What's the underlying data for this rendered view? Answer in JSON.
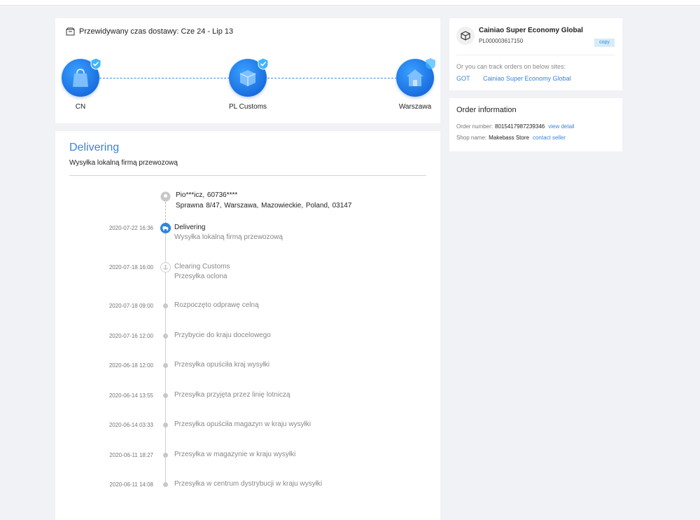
{
  "progress": {
    "eta_text": "Przewidywany czas dostawy: Cze 24 - Lip 13",
    "stages": [
      {
        "label": "CN",
        "icon": "shopping-bag-icon",
        "done": true
      },
      {
        "label": "PL Customs",
        "icon": "package-icon",
        "done": true
      },
      {
        "label": "Warszawa",
        "icon": "house-icon",
        "done": false
      }
    ]
  },
  "status": {
    "title": "Delivering",
    "subtitle": "Wysyłka lokalną firmą przewozową"
  },
  "address": {
    "line1": "Pio***icz,  60736****",
    "line2": "Sprawna 8/47,  Warszawa,  Mazowieckie,  Poland,  03147"
  },
  "events": [
    {
      "date": "2020-07-22 16:36",
      "title": "Delivering",
      "sub": "Wysyłka lokalną firmą przewozową",
      "kind": "active"
    },
    {
      "date": "2020-07-18 16:00",
      "title": "Clearing Customs",
      "sub": "Przesyłka oclona",
      "kind": "milestone"
    },
    {
      "date": "2020-07-18 09:00",
      "title": "Rozpoczęto odprawę celną",
      "sub": "",
      "kind": "normal"
    },
    {
      "date": "2020-07-16 12:00",
      "title": "Przybycie do kraju docelowego",
      "sub": "",
      "kind": "normal"
    },
    {
      "date": "2020-06-18 12:00",
      "title": "Przesyłka opuściła kraj wysyłki",
      "sub": "",
      "kind": "normal"
    },
    {
      "date": "2020-06-14 13:55",
      "title": "Przesyłka przyjęta przez linię lotniczą",
      "sub": "",
      "kind": "normal"
    },
    {
      "date": "2020-06-14 03:33",
      "title": "Przesyłka opuściła magazyn w kraju wysyłki",
      "sub": "",
      "kind": "normal"
    },
    {
      "date": "2020-06-11 18:27",
      "title": "Przesyłka w magazynie w kraju wysyłki",
      "sub": "",
      "kind": "normal"
    },
    {
      "date": "2020-06-11 14:08",
      "title": "Przesyłka w centrum dystrybucji w kraju wysyłki",
      "sub": "",
      "kind": "normal"
    }
  ],
  "carrier": {
    "name": "Cainiao Super Economy Global",
    "tracking": "PL000003617150",
    "copy_label": "copy",
    "other_sites_text": "Or you can track orders on below sites:",
    "links": [
      "GOT",
      "Cainiao Super Economy Global"
    ]
  },
  "order": {
    "title": "Order information",
    "number_label": "Order number:",
    "number": "8015417987239346",
    "view_detail": "view detail",
    "shop_label": "Shop name:",
    "shop": "Makebass Store",
    "contact": "contact seller"
  },
  "colors": {
    "accent": "#3a84d6",
    "stage_blue": "#1a6fe0",
    "check": "#40b4ff"
  }
}
